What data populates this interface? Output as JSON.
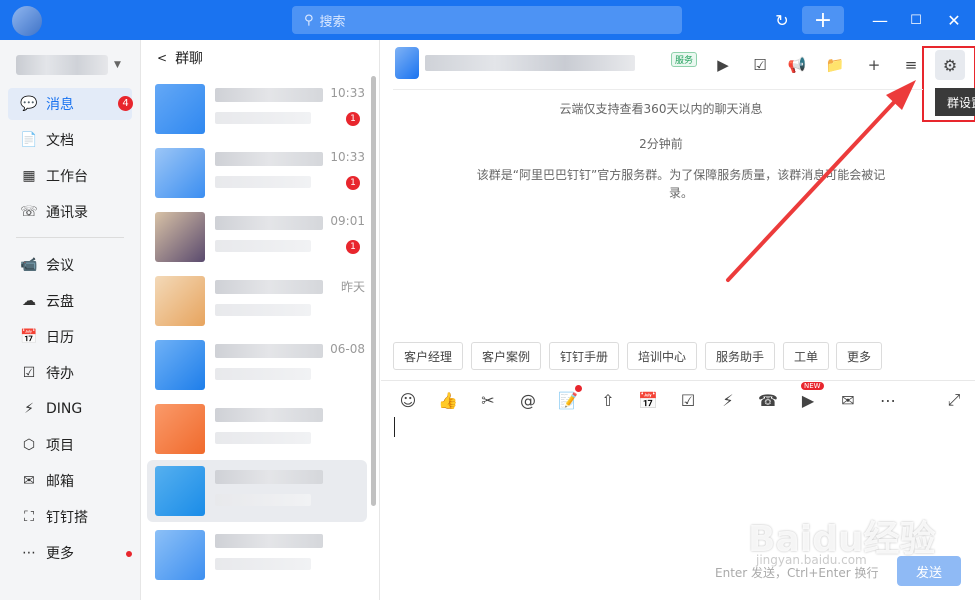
{
  "titlebar": {
    "search_placeholder": "搜索",
    "history_icon": "history-icon",
    "plus_label": "+",
    "min_label": "—",
    "max_label": "☐",
    "close_label": "✕"
  },
  "nav": {
    "items": [
      {
        "label": "消息",
        "icon": "💬",
        "badge": "4"
      },
      {
        "label": "文档",
        "icon": "📄"
      },
      {
        "label": "工作台",
        "icon": "▦"
      },
      {
        "label": "通讯录",
        "icon": "☏"
      },
      {
        "label": "会议",
        "icon": "📹"
      },
      {
        "label": "云盘",
        "icon": "☁"
      },
      {
        "label": "日历",
        "icon": "📅"
      },
      {
        "label": "待办",
        "icon": "☑"
      },
      {
        "label": "DING",
        "icon": "⚡"
      },
      {
        "label": "项目",
        "icon": "⬡"
      },
      {
        "label": "邮箱",
        "icon": "✉"
      },
      {
        "label": "钉钉搭",
        "icon": "⛶"
      },
      {
        "label": "更多",
        "icon": "⋯"
      }
    ]
  },
  "conversations": {
    "header": "群聊",
    "back": "<",
    "items": [
      {
        "time": "10:33",
        "badge": "1"
      },
      {
        "time": "10:33",
        "badge": "1"
      },
      {
        "time": "09:01",
        "badge": "1"
      },
      {
        "time": "昨天"
      },
      {
        "time": "06-08"
      },
      {
        "time": ""
      },
      {
        "time": ""
      },
      {
        "time": ""
      }
    ]
  },
  "chat": {
    "service_tag": "服务",
    "tooltip": "群设置",
    "sys_retention": "云端仅支持查看360天以内的聊天消息",
    "sys_time": "2分钟前",
    "sys_notice": "该群是“阿里巴巴钉钉”官方服务群。为了保障服务质量，该群消息可能会被记录。",
    "quick_actions": [
      "客户经理",
      "客户案例",
      "钉钉手册",
      "培训中心",
      "服务助手",
      "工单",
      "更多"
    ],
    "new_tag": "NEW",
    "send_hint": "Enter 发送，Ctrl+Enter 换行",
    "send_label": "发送"
  },
  "watermark": {
    "main": "Baidu经验",
    "sub": "jingyan.baidu.com"
  }
}
